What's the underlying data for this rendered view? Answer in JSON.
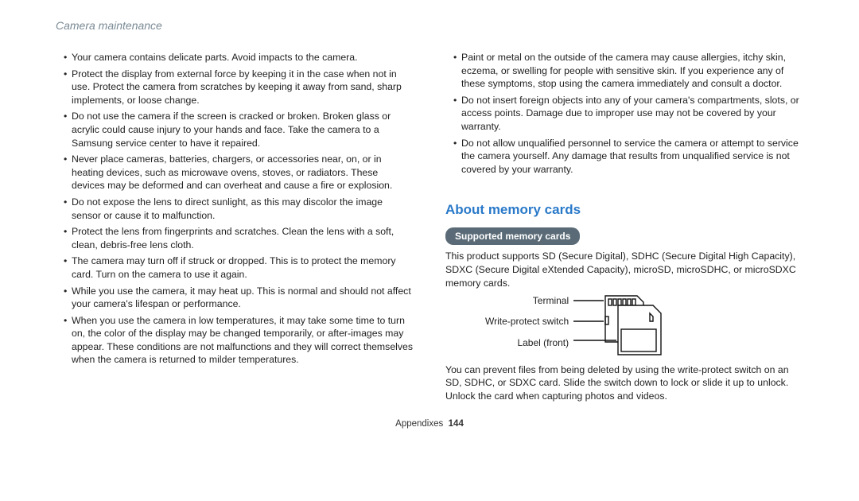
{
  "header": {
    "title": "Camera maintenance"
  },
  "left": {
    "items": [
      "Your camera contains delicate parts. Avoid impacts to the camera.",
      "Protect the display from external force by keeping it in the case when not in use. Protect the camera from scratches by keeping it away from sand, sharp implements, or loose change.",
      "Do not use the camera if the screen is cracked or broken. Broken glass or acrylic could cause injury to your hands and face. Take the camera to a Samsung service center to have it repaired.",
      "Never place cameras, batteries, chargers, or accessories near, on, or in heating devices, such as microwave ovens, stoves, or radiators. These devices may be deformed and can overheat and cause a fire or explosion.",
      "Do not expose the lens to direct sunlight, as this may discolor the image sensor or cause it to malfunction.",
      "Protect the lens from fingerprints and scratches. Clean the lens with a soft, clean, debris-free lens cloth.",
      "The camera may turn off if struck or dropped. This is to protect the memory card. Turn on the camera to use it again.",
      "While you use the camera, it may heat up. This is normal and should not affect your camera's lifespan or performance.",
      "When you use the camera in low temperatures, it may take some time to turn on, the color of the display may be changed temporarily, or after-images may appear. These conditions are not malfunctions and they will correct themselves when the camera is returned to milder temperatures."
    ]
  },
  "right": {
    "items": [
      "Paint or metal on the outside of the camera may cause allergies, itchy skin, eczema, or swelling for people with sensitive skin. If you experience any of these symptoms, stop using the camera immediately and consult a doctor.",
      "Do not insert foreign objects into any of your camera's compartments, slots, or access points. Damage due to improper use may not be covered by your warranty.",
      "Do not allow unqualified personnel to service the camera or attempt to service the camera yourself. Any damage that results from unqualified service is not covered by your warranty."
    ],
    "section_title": "About memory cards",
    "pill": "Supported memory cards",
    "para1": "This product supports SD (Secure Digital), SDHC (Secure Digital High Capacity), SDXC (Secure Digital eXtended Capacity), microSD, microSDHC, or microSDXC memory cards.",
    "diag": {
      "l1": "Terminal",
      "l2": "Write-protect switch",
      "l3": "Label (front)"
    },
    "para2": "You can prevent files from being deleted by using the write-protect switch on an SD, SDHC, or SDXC card. Slide the switch down to lock or slide it up to unlock. Unlock the card when capturing photos and videos."
  },
  "footer": {
    "section": "Appendixes",
    "page": "144"
  }
}
